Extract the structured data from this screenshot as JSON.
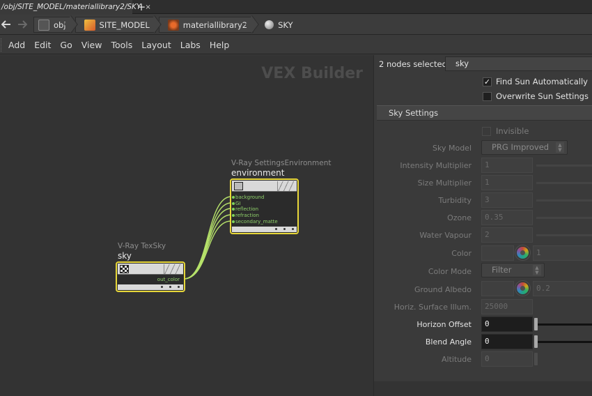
{
  "tab": {
    "title": "/obj/SITE_MODEL/materiallibrary2/SKY",
    "close": "×",
    "add": "+"
  },
  "nav": {
    "back": "back-arrow",
    "forward": "forward-arrow"
  },
  "breadcrumbs": [
    {
      "label": "obj",
      "icon": "object-network-icon"
    },
    {
      "label": "SITE_MODEL",
      "icon": "geometry-icon"
    },
    {
      "label": "materiallibrary2",
      "icon": "material-library-icon"
    },
    {
      "label": "SKY",
      "icon": "vop-sphere-icon"
    }
  ],
  "menu": [
    "Add",
    "Edit",
    "Go",
    "View",
    "Tools",
    "Layout",
    "Labs",
    "Help"
  ],
  "network": {
    "context_label": "VEX Builder",
    "nodes": [
      {
        "type": "V-Ray TexSky",
        "name": "sky",
        "outputs": [
          "out_color"
        ]
      },
      {
        "type": "V-Ray SettingsEnvironment",
        "name": "environment",
        "inputs": [
          "background",
          "GI",
          "reflection",
          "refraction",
          "secondary_matte"
        ]
      }
    ],
    "colors": {
      "selected_outline": "#e8d83a",
      "wire": "#b6e26a",
      "port": "#8fd16a"
    }
  },
  "params": {
    "selection_label": "2 nodes selected:",
    "selection_value": "sky",
    "find_sun": {
      "label": "Find Sun Automatically",
      "checked": true,
      "mark": "✓"
    },
    "overwrite_sun": {
      "label": "Overwrite Sun Settings",
      "checked": false
    },
    "section_title": "Sky Settings",
    "invisible": {
      "label": "Invisible",
      "checked": false
    },
    "sky_model": {
      "label": "Sky Model",
      "value": "PRG Improved"
    },
    "intensity_multiplier": {
      "label": "Intensity Multiplier",
      "value": "1"
    },
    "size_multiplier": {
      "label": "Size Multiplier",
      "value": "1"
    },
    "turbidity": {
      "label": "Turbidity",
      "value": "3"
    },
    "ozone": {
      "label": "Ozone",
      "value": "0.35"
    },
    "water_vapour": {
      "label": "Water Vapour",
      "value": "2"
    },
    "color": {
      "label": "Color",
      "value": "1"
    },
    "color_mode": {
      "label": "Color Mode",
      "value": "Filter"
    },
    "ground_albedo": {
      "label": "Ground Albedo",
      "value": "0.2"
    },
    "horiz_surface_illum": {
      "label": "Horiz. Surface Illum.",
      "value": "25000"
    },
    "horizon_offset": {
      "label": "Horizon Offset",
      "value": "0"
    },
    "blend_angle": {
      "label": "Blend Angle",
      "value": "0"
    },
    "altitude": {
      "label": "Altitude",
      "value": "0"
    }
  }
}
